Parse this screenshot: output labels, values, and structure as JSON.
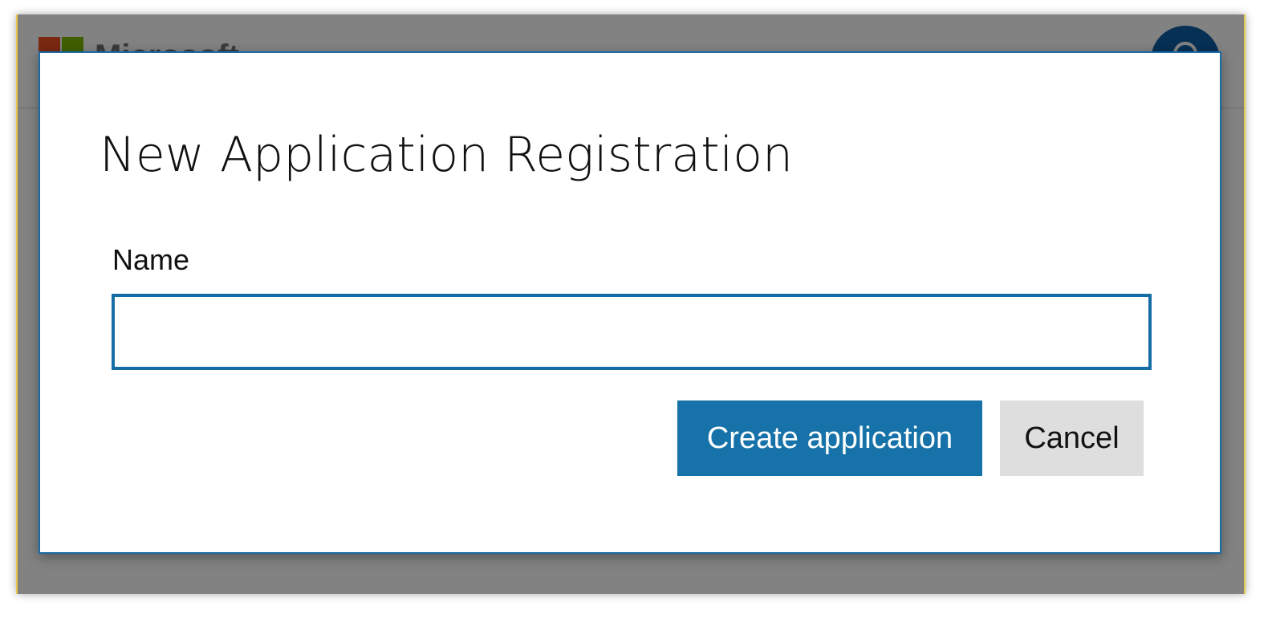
{
  "background_page": {
    "brand": {
      "name": "Microsoft",
      "logo_colors": [
        "#f25022",
        "#7fba00",
        "#00a4ef",
        "#ffb900"
      ]
    },
    "avatar": {
      "icon": "user-icon",
      "color": "#0f5fa8"
    }
  },
  "dialog": {
    "title": "New Application Registration",
    "name_field": {
      "label": "Name",
      "value": "",
      "placeholder": ""
    },
    "buttons": {
      "create_label": "Create application",
      "cancel_label": "Cancel"
    },
    "colors": {
      "accent": "#1672a8",
      "secondary_button": "#dedede"
    }
  }
}
